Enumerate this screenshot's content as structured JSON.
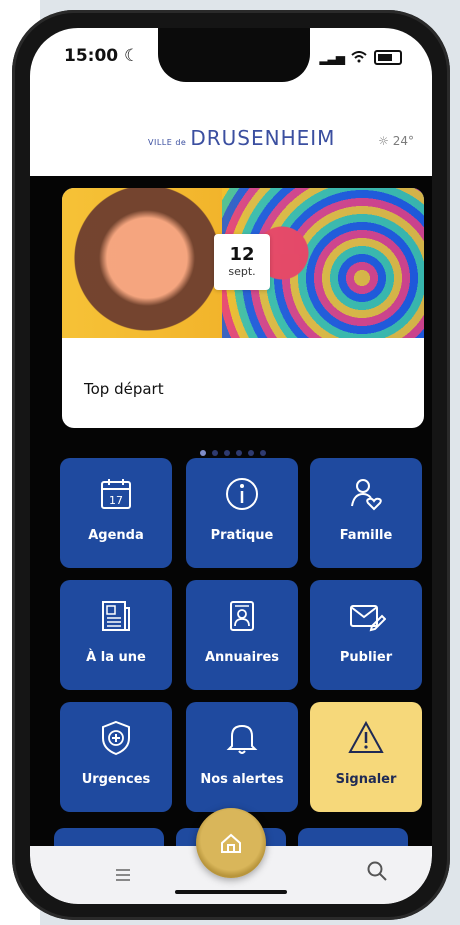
{
  "status": {
    "time": "15:00"
  },
  "brand": {
    "prefix": "VILLE de",
    "name": "DRUSENHEIM"
  },
  "weather": {
    "text": "24°",
    "icon": "sun-icon"
  },
  "carousel": {
    "cards": [
      {
        "day": "12",
        "month": "sept.",
        "title": "Top départ"
      }
    ],
    "dots_count": 6,
    "active_index": 0
  },
  "tiles": [
    {
      "label": "Agenda",
      "icon": "calendar-icon",
      "icon_text": "17"
    },
    {
      "label": "Pratique",
      "icon": "info-icon"
    },
    {
      "label": "Famille",
      "icon": "family-icon"
    },
    {
      "label": "À la une",
      "icon": "newspaper-icon"
    },
    {
      "label": "Annuaires",
      "icon": "directory-icon"
    },
    {
      "label": "Publier",
      "icon": "send-icon"
    },
    {
      "label": "Urgences",
      "icon": "shield-plus-icon"
    },
    {
      "label": "Nos alertes",
      "icon": "bell-icon"
    },
    {
      "label": "Signaler",
      "icon": "warning-icon"
    }
  ],
  "nav": {
    "menu_icon": "menu-icon",
    "home_icon": "home-icon",
    "search_icon": "search-icon"
  },
  "colors": {
    "tile": "#1f4a9f",
    "tile_highlight": "#f6d87a",
    "home": "#c9a64a",
    "brand": "#3b4fa0"
  }
}
